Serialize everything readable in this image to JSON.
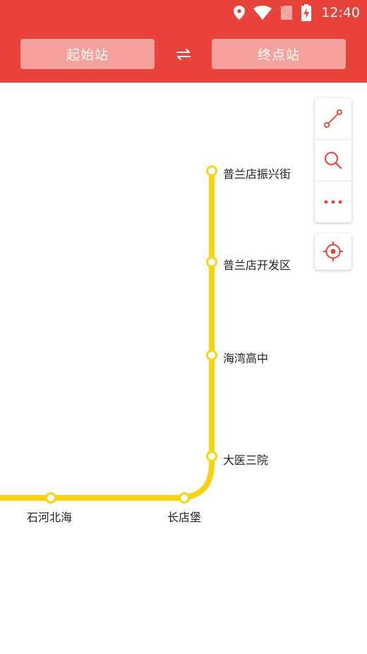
{
  "status_bar": {
    "time": "12:40",
    "icons": [
      "location-icon",
      "wifi-icon",
      "no-sim-icon",
      "battery-charging-icon"
    ]
  },
  "header": {
    "start_station_label": "起始站",
    "end_station_label": "终点站",
    "swap_icon": "swap-arrows-icon"
  },
  "colors": {
    "header": "#e8423a",
    "button": "#f4a09b",
    "line": "#f9d30f",
    "accent": "#e8423a"
  },
  "map": {
    "line_color": "#f9d30f",
    "stations": [
      {
        "name": "普兰店振兴街"
      },
      {
        "name": "普兰店开发区"
      },
      {
        "name": "海湾高中"
      },
      {
        "name": "大医三院"
      },
      {
        "name": "长店堡"
      },
      {
        "name": "石河北海"
      }
    ]
  },
  "toolbar": {
    "tools": [
      "route-icon",
      "search-icon",
      "more-icon"
    ],
    "locate": "locate-icon"
  }
}
